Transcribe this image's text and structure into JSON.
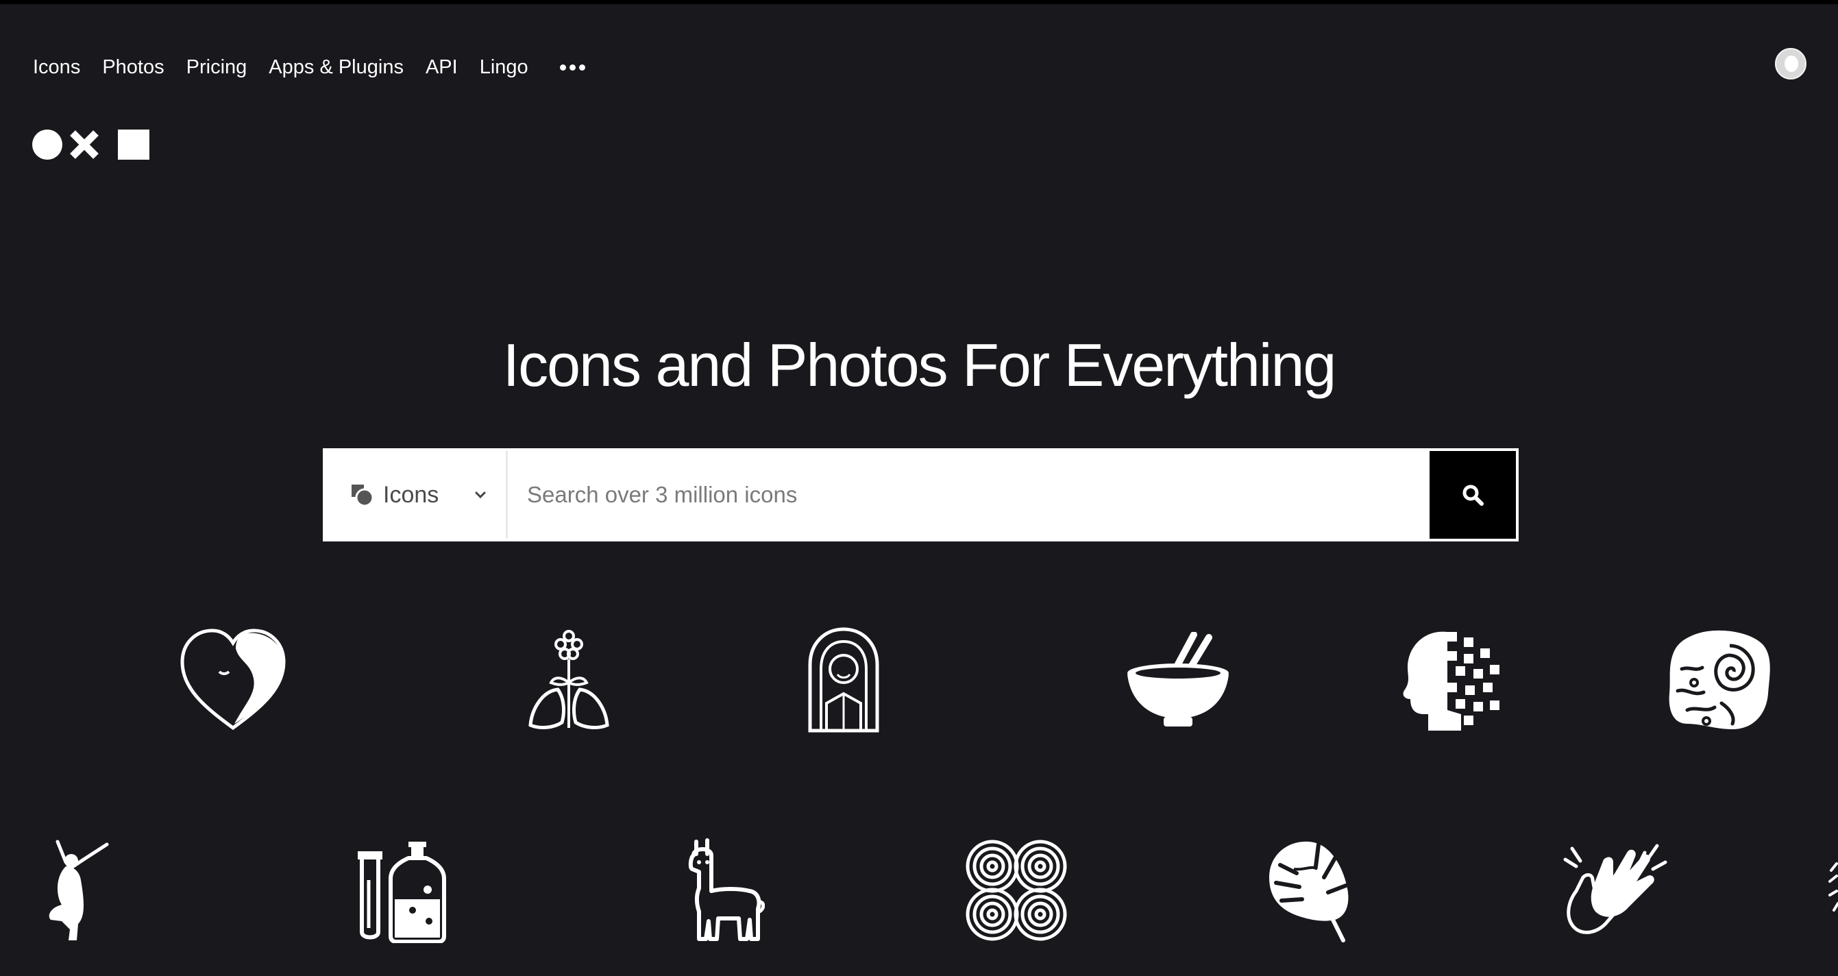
{
  "nav": {
    "items": [
      {
        "label": "Icons"
      },
      {
        "label": "Photos"
      },
      {
        "label": "Pricing"
      },
      {
        "label": "Apps & Plugins"
      },
      {
        "label": "API"
      },
      {
        "label": "Lingo"
      }
    ],
    "more_icon": "more-dots-icon"
  },
  "brand": {
    "logo": "circle-x-square-logo"
  },
  "hero": {
    "title": "Icons and Photos For Everything"
  },
  "search": {
    "type_label": "Icons",
    "placeholder": "Search over 3 million icons",
    "value": "",
    "button_icon": "search-icon"
  },
  "showcase": {
    "row1": [
      "heart-face-icon",
      "lungs-flower-icon",
      "woman-portrait-icon",
      "bowl-chopsticks-icon",
      "pixel-head-icon",
      "fossil-stone-icon"
    ],
    "row2": [
      "dancing-person-icon",
      "test-tube-bottle-icon",
      "llama-icon",
      "spiral-pattern-icon",
      "monstera-leaf-icon",
      "clapping-hands-icon"
    ]
  },
  "colors": {
    "background": "#18181d",
    "foreground": "#ffffff",
    "button": "#000000"
  }
}
